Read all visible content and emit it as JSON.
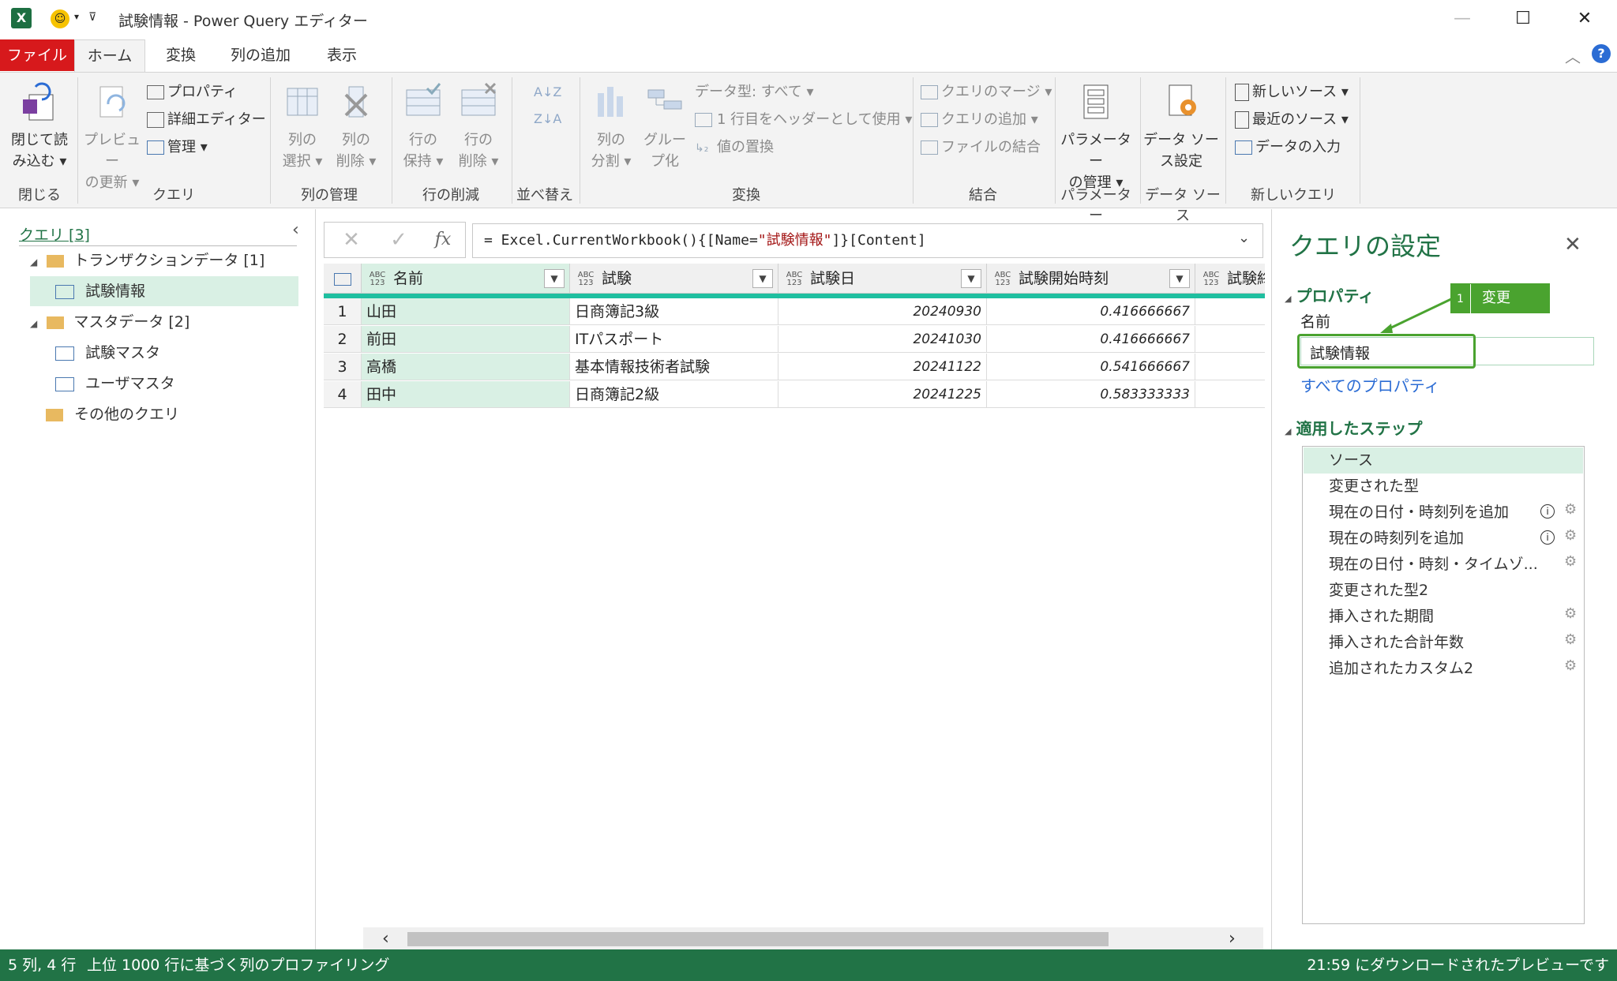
{
  "window": {
    "title": "試験情報 - Power Query エディター",
    "controls": [
      "—",
      "☐",
      "✕"
    ]
  },
  "tabs": {
    "file": "ファイル",
    "home": "ホーム",
    "transform": "変換",
    "add_column": "列の追加",
    "view": "表示"
  },
  "ribbon": {
    "close": {
      "btn_line1": "閉じて読",
      "btn_line2": "み込む ▾",
      "label": "閉じる"
    },
    "query": {
      "preview_line1": "プレビュー",
      "preview_line2": "の更新 ▾",
      "properties": "プロパティ",
      "advanced_editor": "詳細エディター",
      "manage": "管理 ▾",
      "label": "クエリ"
    },
    "manage_columns": {
      "select_line1": "列の",
      "select_line2": "選択 ▾",
      "remove_line1": "列の",
      "remove_line2": "削除 ▾",
      "label": "列の管理"
    },
    "reduce_rows": {
      "keep_line1": "行の",
      "keep_line2": "保持 ▾",
      "remove_line1": "行の",
      "remove_line2": "削除 ▾",
      "label": "行の削減"
    },
    "sort": {
      "label": "並べ替え"
    },
    "transform": {
      "split_line1": "列の",
      "split_line2": "分割 ▾",
      "group_line1": "グルー",
      "group_line2": "プ化",
      "datatype": "データ型: すべて ▾",
      "first_row_header": "1 行目をヘッダーとして使用 ▾",
      "replace_values": "値の置換",
      "label": "変換"
    },
    "combine": {
      "merge": "クエリのマージ ▾",
      "append": "クエリの追加 ▾",
      "combine_files": "ファイルの結合",
      "label": "結合"
    },
    "parameters": {
      "btn_line1": "パラメーター",
      "btn_line2": "の管理 ▾",
      "label": "パラメーター"
    },
    "datasource": {
      "btn_line1": "データ ソー",
      "btn_line2": "ス設定",
      "label": "データ ソース"
    },
    "new_query": {
      "new_source": "新しいソース ▾",
      "recent_sources": "最近のソース ▾",
      "enter_data": "データの入力",
      "label": "新しいクエリ"
    }
  },
  "left_panel": {
    "header": "クエリ [3]",
    "items": [
      {
        "label": "トランザクションデータ [1]"
      },
      {
        "label": "試験情報"
      },
      {
        "label": "マスタデータ [2]"
      },
      {
        "label": "試験マスタ"
      },
      {
        "label": "ユーザマスタ"
      },
      {
        "label": "その他のクエリ"
      }
    ]
  },
  "formula": {
    "prefix": "= Excel.CurrentWorkbook(){[Name=",
    "name": "\"試験情報\"",
    "suffix": "]}[Content]",
    "fx": "fx"
  },
  "grid": {
    "type_label_top": "ABC",
    "type_label_bottom": "123",
    "columns": [
      "名前",
      "試験",
      "試験日",
      "試験開始時刻",
      "試験終"
    ],
    "rows": [
      {
        "n": "1",
        "name": "山田",
        "exam": "日商簿記3級",
        "date": "20240930",
        "time": "0.416666667"
      },
      {
        "n": "2",
        "name": "前田",
        "exam": "ITパスポート",
        "date": "20241030",
        "time": "0.416666667"
      },
      {
        "n": "3",
        "name": "高橋",
        "exam": "基本情報技術者試験",
        "date": "20241122",
        "time": "0.541666667"
      },
      {
        "n": "4",
        "name": "田中",
        "exam": "日商簿記2級",
        "date": "20241225",
        "time": "0.583333333"
      }
    ]
  },
  "right_panel": {
    "title": "クエリの設定",
    "properties_title": "プロパティ",
    "name_label": "名前",
    "name_value": "試験情報",
    "all_properties": "すべてのプロパティ",
    "steps_title": "適用したステップ",
    "steps": [
      {
        "label": "ソース"
      },
      {
        "label": "変更された型"
      },
      {
        "label": "現在の日付・時刻列を追加"
      },
      {
        "label": "現在の時刻列を追加"
      },
      {
        "label": "現在の日付・時刻・タイムゾ..."
      },
      {
        "label": "変更された型2"
      },
      {
        "label": "挿入された期間"
      },
      {
        "label": "挿入された合計年数"
      },
      {
        "label": "追加されたカスタム2"
      }
    ]
  },
  "callout": {
    "number": "1",
    "text": "変更"
  },
  "status": {
    "left1": "5 列, 4 行",
    "left2": "上位 1000 行に基づく列のプロファイリング",
    "right": "21:59 にダウンロードされたプレビューです"
  },
  "colors": {
    "accent": "#217346",
    "file_tab": "#d7191c",
    "selection": "#d9f0e4",
    "teal": "#1fbfa0",
    "callout": "#4aa32f"
  }
}
